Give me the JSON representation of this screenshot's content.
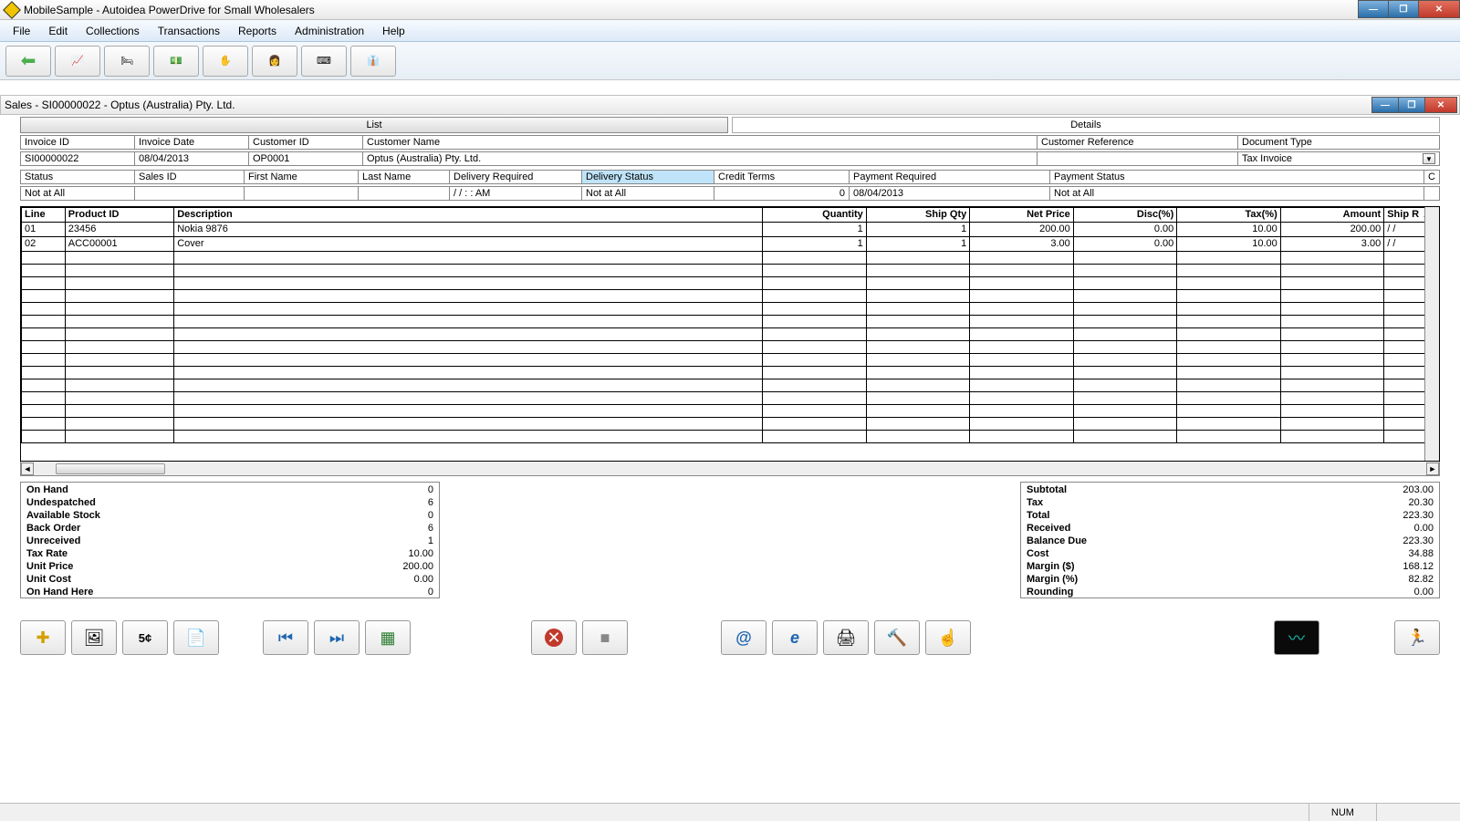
{
  "app": {
    "title": "MobileSample - Autoidea PowerDrive for Small Wholesalers"
  },
  "menu": [
    "File",
    "Edit",
    "Collections",
    "Transactions",
    "Reports",
    "Administration",
    "Help"
  ],
  "child": {
    "title": "Sales - SI00000022 - Optus (Australia) Pty. Ltd."
  },
  "tabs": {
    "list": "List",
    "details": "Details"
  },
  "header_labels": {
    "invoice_id": "Invoice ID",
    "invoice_date": "Invoice Date",
    "customer_id": "Customer ID",
    "customer_name": "Customer Name",
    "customer_reference": "Customer Reference",
    "document_type": "Document Type"
  },
  "header_values": {
    "invoice_id": "SI00000022",
    "invoice_date": "08/04/2013",
    "customer_id": "OP0001",
    "customer_name": "Optus (Australia) Pty. Ltd.",
    "customer_reference": "",
    "document_type": "Tax Invoice"
  },
  "row2_labels": {
    "status": "Status",
    "sales_id": "Sales ID",
    "first_name": "First Name",
    "last_name": "Last Name",
    "delivery_required": "Delivery Required",
    "delivery_status": "Delivery Status",
    "credit_terms": "Credit Terms",
    "payment_required": "Payment Required",
    "payment_status": "Payment Status",
    "c": "C"
  },
  "row2_values": {
    "status": "Not at All",
    "sales_id": "",
    "first_name": "",
    "last_name": "",
    "delivery_required": "/ /     : :   AM",
    "delivery_status": "Not at All",
    "credit_terms": "0",
    "payment_required": "08/04/2013",
    "payment_status": "Not at All",
    "c": ""
  },
  "grid": {
    "columns": [
      "Line",
      "Product ID",
      "Description",
      "Quantity",
      "Ship Qty",
      "Net Price",
      "Disc(%)",
      "Tax(%)",
      "Amount",
      "Ship R"
    ],
    "rows": [
      {
        "line": "01",
        "product": "23456",
        "desc": "Nokia 9876",
        "qty": "1",
        "shipqty": "1",
        "net": "200.00",
        "disc": "0.00",
        "tax": "10.00",
        "amount": "200.00",
        "shipr": "/ /"
      },
      {
        "line": "02",
        "product": "ACC00001",
        "desc": "Cover",
        "qty": "1",
        "shipqty": "1",
        "net": "3.00",
        "disc": "0.00",
        "tax": "10.00",
        "amount": "3.00",
        "shipr": "/ /"
      }
    ]
  },
  "left_summary": [
    {
      "label": "On Hand",
      "value": "0"
    },
    {
      "label": "Undespatched",
      "value": "6"
    },
    {
      "label": "Available Stock",
      "value": "0"
    },
    {
      "label": "Back Order",
      "value": "6"
    },
    {
      "label": "Unreceived",
      "value": "1"
    },
    {
      "label": "Tax Rate",
      "value": "10.00"
    },
    {
      "label": "Unit Price",
      "value": "200.00"
    },
    {
      "label": "Unit Cost",
      "value": "0.00"
    },
    {
      "label": "On Hand Here",
      "value": "0"
    }
  ],
  "right_summary": [
    {
      "label": "Subtotal",
      "value": "203.00"
    },
    {
      "label": "Tax",
      "value": "20.30"
    },
    {
      "label": "Total",
      "value": "223.30"
    },
    {
      "label": "Received",
      "value": "0.00"
    },
    {
      "label": "Balance Due",
      "value": "223.30"
    },
    {
      "label": "Cost",
      "value": "34.88"
    },
    {
      "label": "Margin ($)",
      "value": "168.12"
    },
    {
      "label": "Margin (%)",
      "value": "82.82"
    },
    {
      "label": "Rounding",
      "value": "0.00"
    }
  ],
  "statusbar": {
    "num": "NUM"
  }
}
